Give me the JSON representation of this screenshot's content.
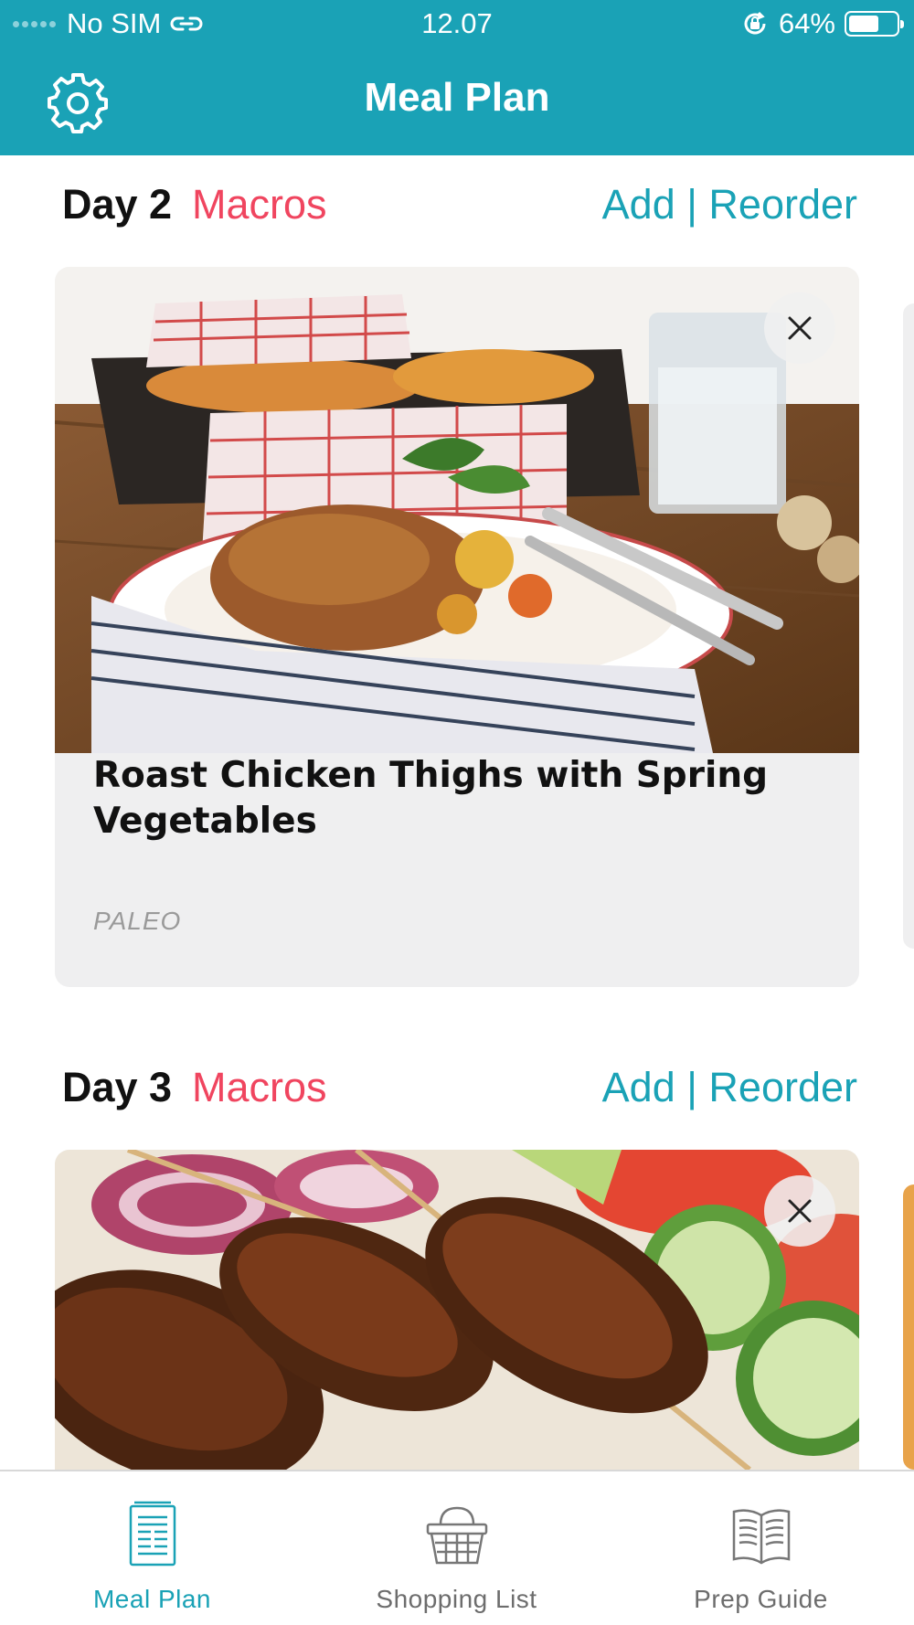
{
  "status_bar": {
    "carrier": "No SIM",
    "time": "12.07",
    "battery_percent": "64%",
    "battery_level": 0.64
  },
  "nav": {
    "title": "Meal Plan",
    "settings_icon": "gear-icon"
  },
  "days": [
    {
      "day_label": "Day 2",
      "macros_label": "Macros",
      "actions_label": "Add | Reorder",
      "meal": {
        "title": "Roast Chicken Thighs with Spring Vegetables",
        "tag": "PALEO",
        "image": "roast-chicken-photo"
      }
    },
    {
      "day_label": "Day 3",
      "macros_label": "Macros",
      "actions_label": "Add | Reorder",
      "meal": {
        "image": "grilled-kebab-photo"
      }
    }
  ],
  "tabs": [
    {
      "label": "Meal Plan",
      "icon": "meal-plan-icon",
      "active": true
    },
    {
      "label": "Shopping List",
      "icon": "basket-icon",
      "active": false
    },
    {
      "label": "Prep Guide",
      "icon": "book-icon",
      "active": false
    }
  ],
  "colors": {
    "brand": "#1aa2b6",
    "accent": "#f0455f",
    "card_bg": "#efeff0"
  }
}
